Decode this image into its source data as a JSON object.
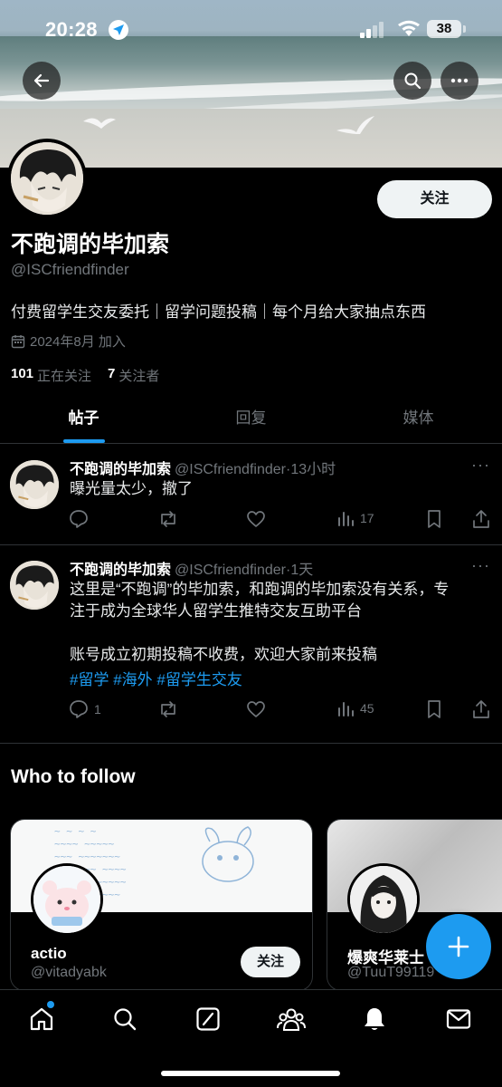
{
  "status_bar": {
    "time": "20:28",
    "battery": "38"
  },
  "profile": {
    "follow_label": "关注",
    "name": "不跑调的毕加索",
    "handle": "@ISCfriendfinder",
    "bio": "付费留学生交友委托｜留学问题投稿｜每个月给大家抽点东西",
    "joined": "2024年8月 加入",
    "following_count": "101",
    "following_label": "正在关注",
    "followers_count": "7",
    "followers_label": "关注者"
  },
  "tabs": [
    {
      "label": "帖子",
      "active": true
    },
    {
      "label": "回复",
      "active": false
    },
    {
      "label": "媒体",
      "active": false
    }
  ],
  "posts": [
    {
      "name": "不跑调的毕加索",
      "handle": "@ISCfriendfinder",
      "time": "·13小时",
      "lines": [
        "曝光量太少，撤了"
      ],
      "replies": "",
      "views": "17"
    },
    {
      "name": "不跑调的毕加索",
      "handle": "@ISCfriendfinder",
      "time": "·1天",
      "lines": [
        "这里是“不跑调”的毕加索，和跑调的毕加索没有关系，专",
        "注于成为全球华人留学生推特交友互助平台",
        "",
        "账号成立初期投稿不收费，欢迎大家前来投稿"
      ],
      "tags": [
        "#留学",
        "#海外",
        "#留学生交友"
      ],
      "replies": "1",
      "views": "45"
    }
  ],
  "who_to_follow": {
    "title": "Who to follow",
    "cards": [
      {
        "name": "actio",
        "handle": "@vitadyabk",
        "follow_label": "关注"
      },
      {
        "name": "爆爽华莱士",
        "handle": "@TuuT99119"
      }
    ]
  },
  "colors": {
    "accent": "#1d9bf0",
    "background": "#000000",
    "muted": "#71767b"
  },
  "icons": {
    "nav": [
      "home-icon",
      "search-icon",
      "grok-icon",
      "communities-icon",
      "notifications-icon",
      "messages-icon"
    ]
  }
}
